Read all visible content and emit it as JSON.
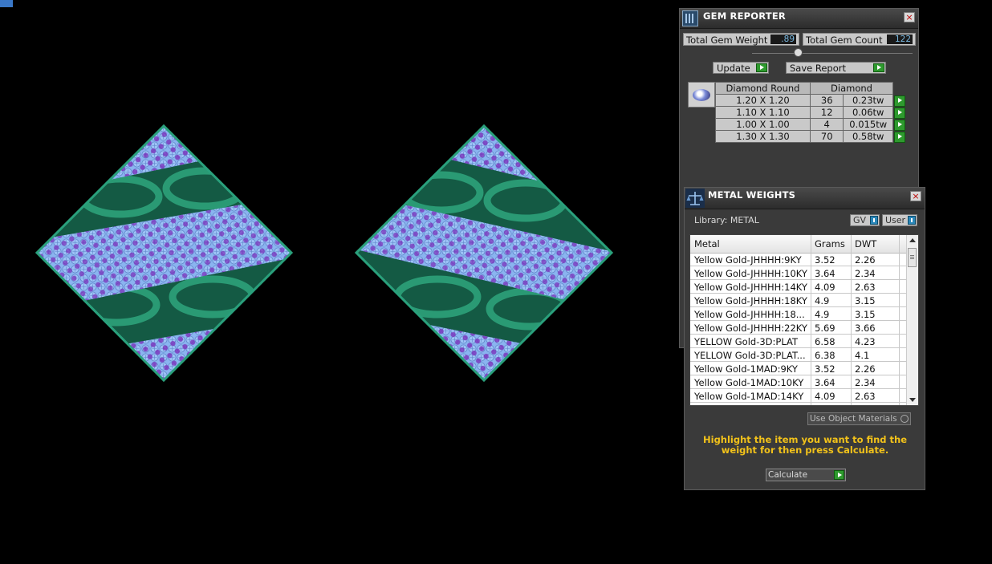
{
  "gem_reporter": {
    "title": "GEM REPORTER",
    "close_label": "×",
    "total_gem_weight_label": "Total Gem Weight",
    "total_gem_weight_value": ".89",
    "total_gem_count_label": "Total Gem Count",
    "total_gem_count_value": "122",
    "update_label": "Update",
    "save_report_label": "Save Report",
    "table": {
      "shape_header": "Diamond Round",
      "material_header": "Diamond",
      "rows": [
        {
          "size": "1.20 X 1.20",
          "count": "36",
          "weight": "0.23tw"
        },
        {
          "size": "1.10 X 1.10",
          "count": "12",
          "weight": "0.06tw"
        },
        {
          "size": "1.00 X 1.00",
          "count": "4",
          "weight": "0.015tw"
        },
        {
          "size": "1.30 X 1.30",
          "count": "70",
          "weight": "0.58tw"
        }
      ]
    }
  },
  "metal_weights": {
    "title": "METAL WEIGHTS",
    "close_label": "×",
    "library_label": "Library: METAL",
    "gv_label": "GV",
    "user_label": "User",
    "columns": [
      "Metal",
      "Grams",
      "DWT"
    ],
    "rows": [
      {
        "metal": "Yellow Gold-JHHHH:9KY",
        "grams": "3.52",
        "dwt": "2.26"
      },
      {
        "metal": "Yellow Gold-JHHHH:10KY",
        "grams": "3.64",
        "dwt": "2.34"
      },
      {
        "metal": "Yellow Gold-JHHHH:14KY",
        "grams": "4.09",
        "dwt": "2.63"
      },
      {
        "metal": "Yellow Gold-JHHHH:18KY",
        "grams": "4.9",
        "dwt": "3.15"
      },
      {
        "metal": "Yellow Gold-JHHHH:18...",
        "grams": "4.9",
        "dwt": "3.15"
      },
      {
        "metal": "Yellow Gold-JHHHH:22KY",
        "grams": "5.69",
        "dwt": "3.66"
      },
      {
        "metal": "YELLOW Gold-3D:PLAT",
        "grams": "6.58",
        "dwt": "4.23"
      },
      {
        "metal": "YELLOW Gold-3D:PLAT...",
        "grams": "6.38",
        "dwt": "4.1"
      },
      {
        "metal": "Yellow Gold-1MAD:9KY",
        "grams": "3.52",
        "dwt": "2.26"
      },
      {
        "metal": "Yellow Gold-1MAD:10KY",
        "grams": "3.64",
        "dwt": "2.34"
      },
      {
        "metal": "Yellow Gold-1MAD:14KY",
        "grams": "4.09",
        "dwt": "2.63"
      }
    ],
    "use_object_materials_label": "Use Object Materials",
    "hint_text": "Highlight the item you want to find the weight for then press Calculate.",
    "calculate_label": "Calculate"
  },
  "colors": {
    "metal_green": "#1f8a64",
    "gem_light_blue": "#8ab4f0",
    "gem_purple": "#7a2ab8",
    "hint_yellow": "#f2c21a",
    "action_green": "#2e9a2e"
  }
}
